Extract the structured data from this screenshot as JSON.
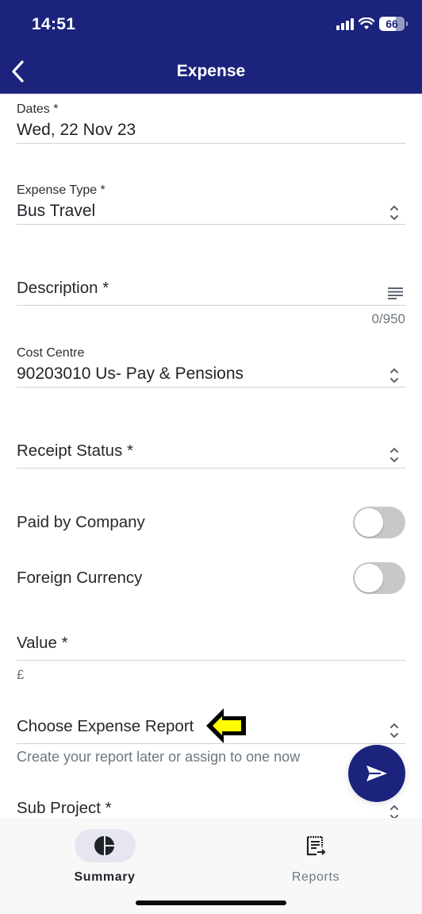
{
  "status_bar": {
    "time": "14:51",
    "battery_level": "66",
    "icons": [
      "signal-icon",
      "wifi-icon",
      "battery-icon"
    ]
  },
  "nav": {
    "title": "Expense",
    "back_icon": "chevron-left-icon"
  },
  "form": {
    "dates": {
      "label": "Dates *",
      "value": "Wed, 22 Nov 23"
    },
    "expense_type": {
      "label": "Expense Type *",
      "value": "Bus Travel",
      "icon": "updown-chevron-icon"
    },
    "description": {
      "label": "Description *",
      "value": "",
      "counter": "0/950",
      "icon": "text-lines-icon"
    },
    "cost_centre": {
      "label": "Cost Centre",
      "value": "90203010 Us- Pay & Pensions",
      "icon": "updown-chevron-icon"
    },
    "receipt_status": {
      "label": "Receipt Status *",
      "value": "",
      "icon": "updown-chevron-icon"
    },
    "paid_by_company": {
      "label": "Paid by Company",
      "on": false
    },
    "foreign_currency": {
      "label": "Foreign Currency",
      "on": false
    },
    "value": {
      "label": "Value *",
      "currency_symbol": "£",
      "value": ""
    },
    "expense_report": {
      "label": "Choose Expense Report",
      "helper": "Create your report later or assign to one now",
      "icon": "updown-chevron-icon"
    },
    "sub_project": {
      "label": "Sub Project *",
      "icon": "updown-chevron-icon"
    }
  },
  "annotation": {
    "icon": "yellow-arrow-left-icon",
    "color": "#ffff00"
  },
  "fab": {
    "icon": "send-icon"
  },
  "bottom_nav": {
    "tabs": [
      {
        "label": "Summary",
        "icon": "pie-chart-icon",
        "active": true
      },
      {
        "label": "Reports",
        "icon": "receipt-icon",
        "active": false
      }
    ]
  },
  "colors": {
    "brand": "#1b237c",
    "toggle_off": "#c8c8c8",
    "helper_text": "#6e7781"
  }
}
